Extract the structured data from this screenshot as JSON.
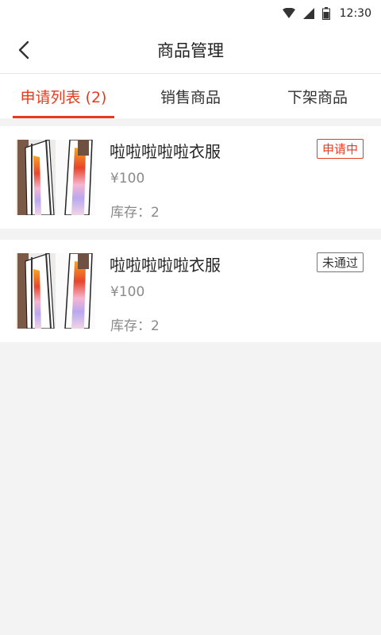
{
  "status_bar": {
    "time": "12:30"
  },
  "app_bar": {
    "title": "商品管理"
  },
  "tabs": [
    {
      "label": "申请列表 (2)",
      "active": true
    },
    {
      "label": "销售商品",
      "active": false
    },
    {
      "label": "下架商品",
      "active": false
    }
  ],
  "products": [
    {
      "name": "啦啦啦啦啦衣服",
      "price": "¥100",
      "stock": "库存：2",
      "status": "申请中"
    },
    {
      "name": "啦啦啦啦啦衣服",
      "price": "¥100",
      "stock": "库存：2",
      "status": "未通过"
    }
  ],
  "colors": {
    "accent": "#e63c1e",
    "background": "#f3f3f3",
    "card": "#ffffff"
  }
}
